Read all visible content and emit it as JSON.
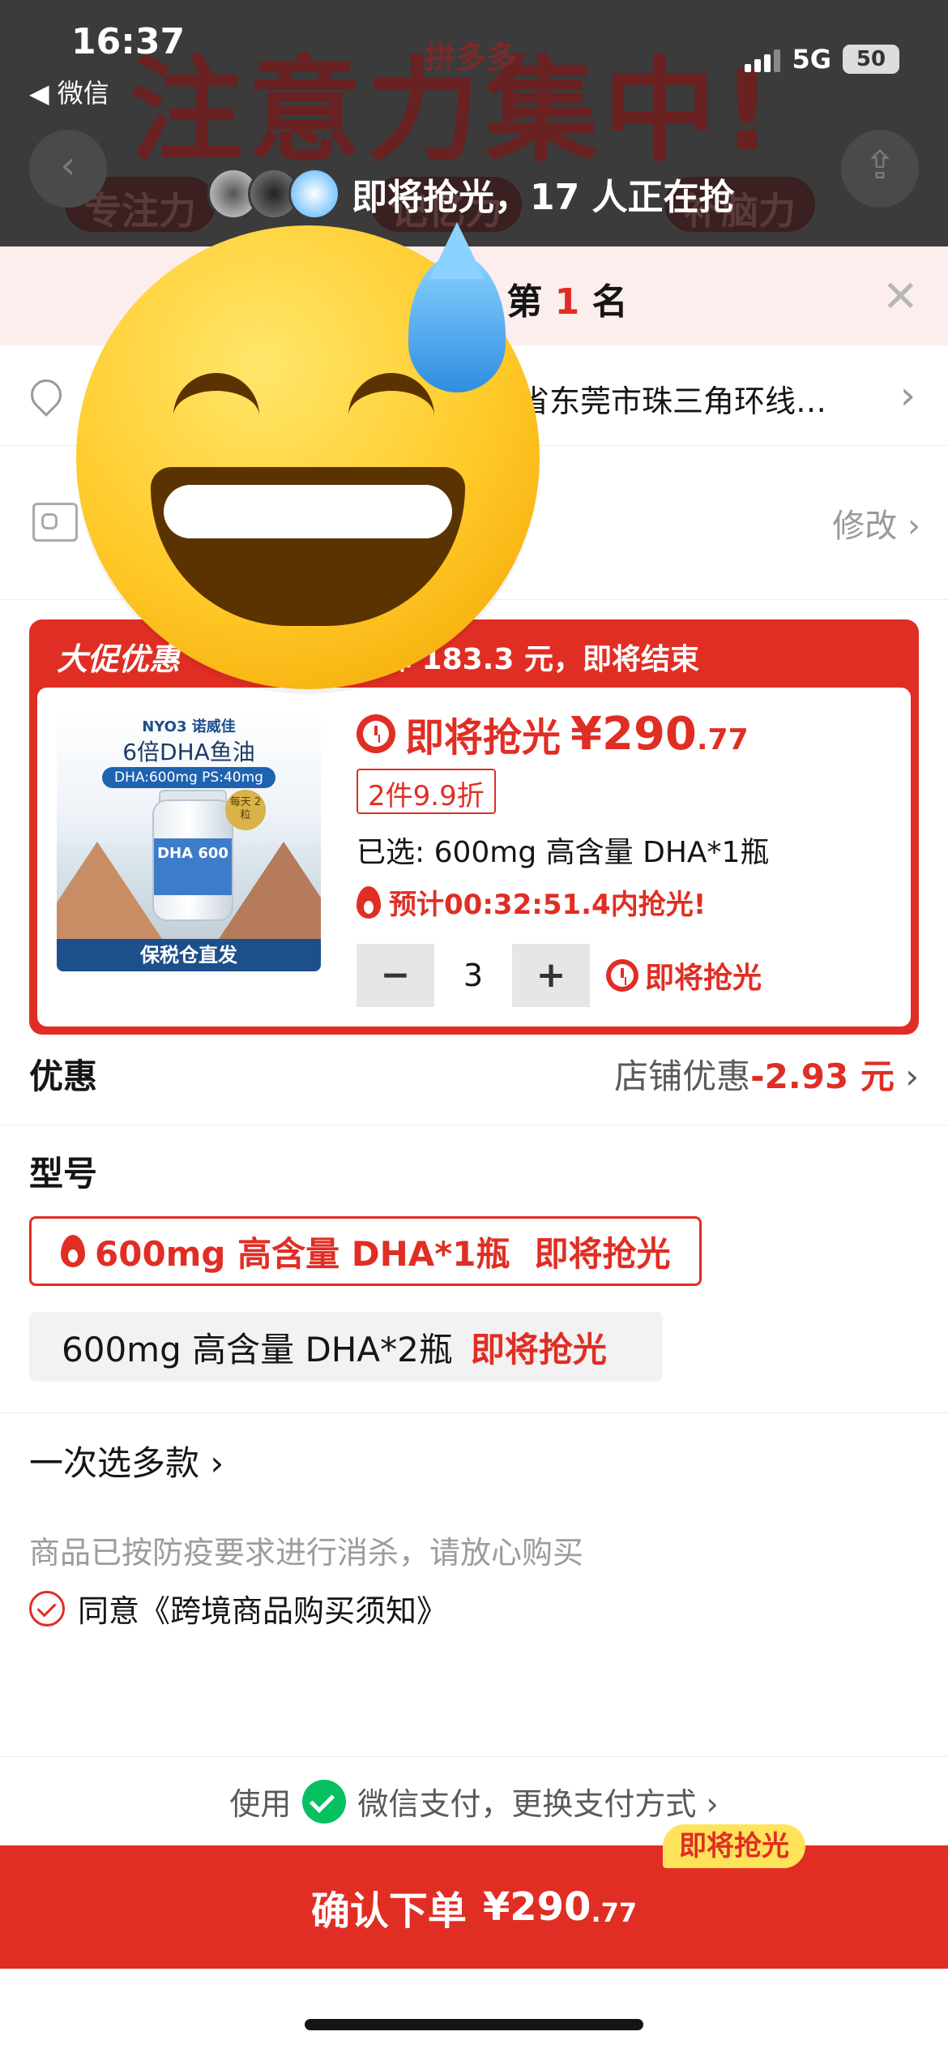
{
  "status_bar": {
    "time": "16:37",
    "back_app": "◀ 微信",
    "network": "5G",
    "battery": "50"
  },
  "banner": {
    "headline": "注意力集中!",
    "logo": "拼多多",
    "tags": [
      "专注力",
      "记忆力",
      "补脑力"
    ]
  },
  "grab": {
    "text": "即将抢光，17 人正在抢"
  },
  "rank": {
    "prefix": "榜 第",
    "number": "1",
    "suffix": "名"
  },
  "address": {
    "text": "省东莞市珠三角环线…"
  },
  "identity": {
    "edit_label": "修改"
  },
  "promo": {
    "head": "大促优惠",
    "head_detail": "直降 183.3 元，即将结束",
    "image": {
      "brand": "NYO3 诺威佳",
      "title": "6倍DHA鱼油",
      "spec": "DHA:600mg  PS:40mg",
      "badge": "每天 2粒",
      "bottle_text": "DHA 600",
      "footer": "保税仓直发"
    },
    "price_label": "即将抢光",
    "price_main": "¥290",
    "price_cents": ".77",
    "discount": "2件9.9折",
    "selected": "已选: 600mg 高含量 DHA*1瓶",
    "countdown": "预计00:32:51.4内抢光!",
    "quantity": "3",
    "qty_hot": "即将抢光"
  },
  "discount_row": {
    "label": "优惠",
    "value_prefix": "店铺优惠",
    "value_amount": "-2.93 元"
  },
  "model": {
    "title": "型号",
    "options": [
      {
        "label": "600mg 高含量 DHA*1瓶",
        "hot": "即将抢光"
      },
      {
        "label": "600mg 高含量 DHA*2瓶",
        "hot": "即将抢光"
      }
    ]
  },
  "multi_select": {
    "label": "一次选多款 ›"
  },
  "notice": "商品已按防疫要求进行消杀，请放心购买",
  "agreement": "同意《跨境商品购买须知》",
  "payment": {
    "prefix": "使用",
    "method": "微信支付，更换支付方式 ›"
  },
  "confirm": {
    "label": "确认下单",
    "price_main": "¥290",
    "price_cents": ".77",
    "badge": "即将抢光"
  },
  "colors": {
    "accent": "#e02e24",
    "wechat": "#07c160",
    "badge_yellow": "#ffe35a"
  }
}
